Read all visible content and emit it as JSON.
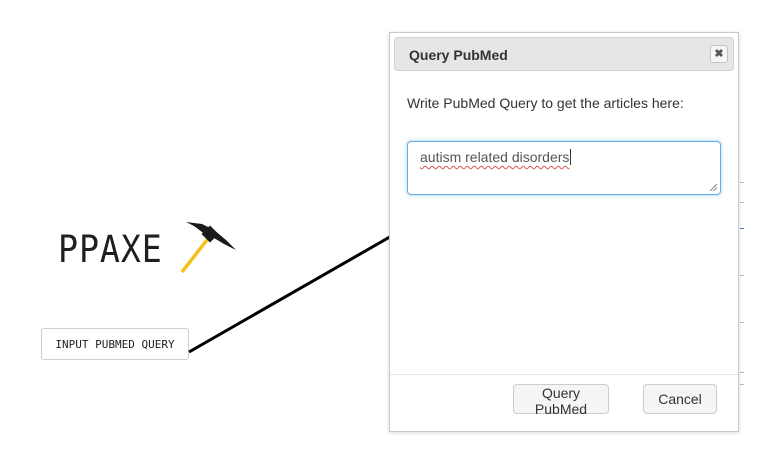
{
  "logo": {
    "text": "PPAXE",
    "icon": "pickaxe-icon",
    "colors": {
      "handle": "#f5c21b",
      "head": "#1a1a1a"
    }
  },
  "main": {
    "input_button_label": "INPUT PUBMED QUERY"
  },
  "dialog": {
    "title": "Query PubMed",
    "close_icon": "close-icon",
    "prompt": "Write PubMed Query to get the articles here:",
    "query_value": "autism related disorders",
    "submit_label": "Query PubMed",
    "cancel_label": "Cancel",
    "colors": {
      "focus_border": "#66afe9",
      "header_bg": "#e6e6e6"
    }
  }
}
